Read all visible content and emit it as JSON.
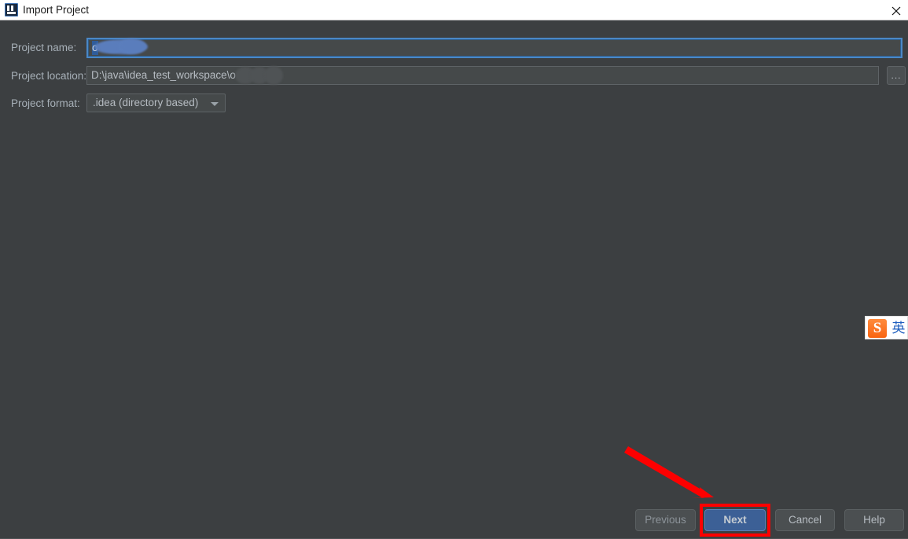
{
  "window": {
    "title": "Import Project",
    "icon": "intellij-idea-logo",
    "close_label": "×",
    "background_color": "#3c3f41",
    "titlebar_background": "#ffffff"
  },
  "form": {
    "fields": [
      {
        "label": "Project name:",
        "value": "o",
        "redacted": true,
        "focused": true,
        "selected": true
      },
      {
        "label": "Project location:",
        "value": "D:\\java\\idea_test_workspace\\o",
        "redacted": true,
        "focused": false
      },
      {
        "label": "Project format:",
        "value": ".idea (directory based)",
        "redacted": false,
        "focused": false
      }
    ],
    "browse_button_label": "...",
    "format_options": [
      ".idea (directory based)"
    ]
  },
  "footer": {
    "buttons": [
      {
        "label": "Previous",
        "state": "disabled",
        "style": "default"
      },
      {
        "label": "Next",
        "state": "enabled",
        "style": "primary"
      },
      {
        "label": "Cancel",
        "state": "enabled",
        "style": "default"
      },
      {
        "label": "Help",
        "state": "enabled",
        "style": "default"
      }
    ]
  },
  "annotations": {
    "color": "#fe0000",
    "highlight_target": "Next",
    "arrow": "points-down-right-to-next-button"
  },
  "ime": {
    "vendor_glyph": "S",
    "mode_glyph": "英",
    "logo_color": "#f96410",
    "mode_color": "#1f5fbf"
  }
}
